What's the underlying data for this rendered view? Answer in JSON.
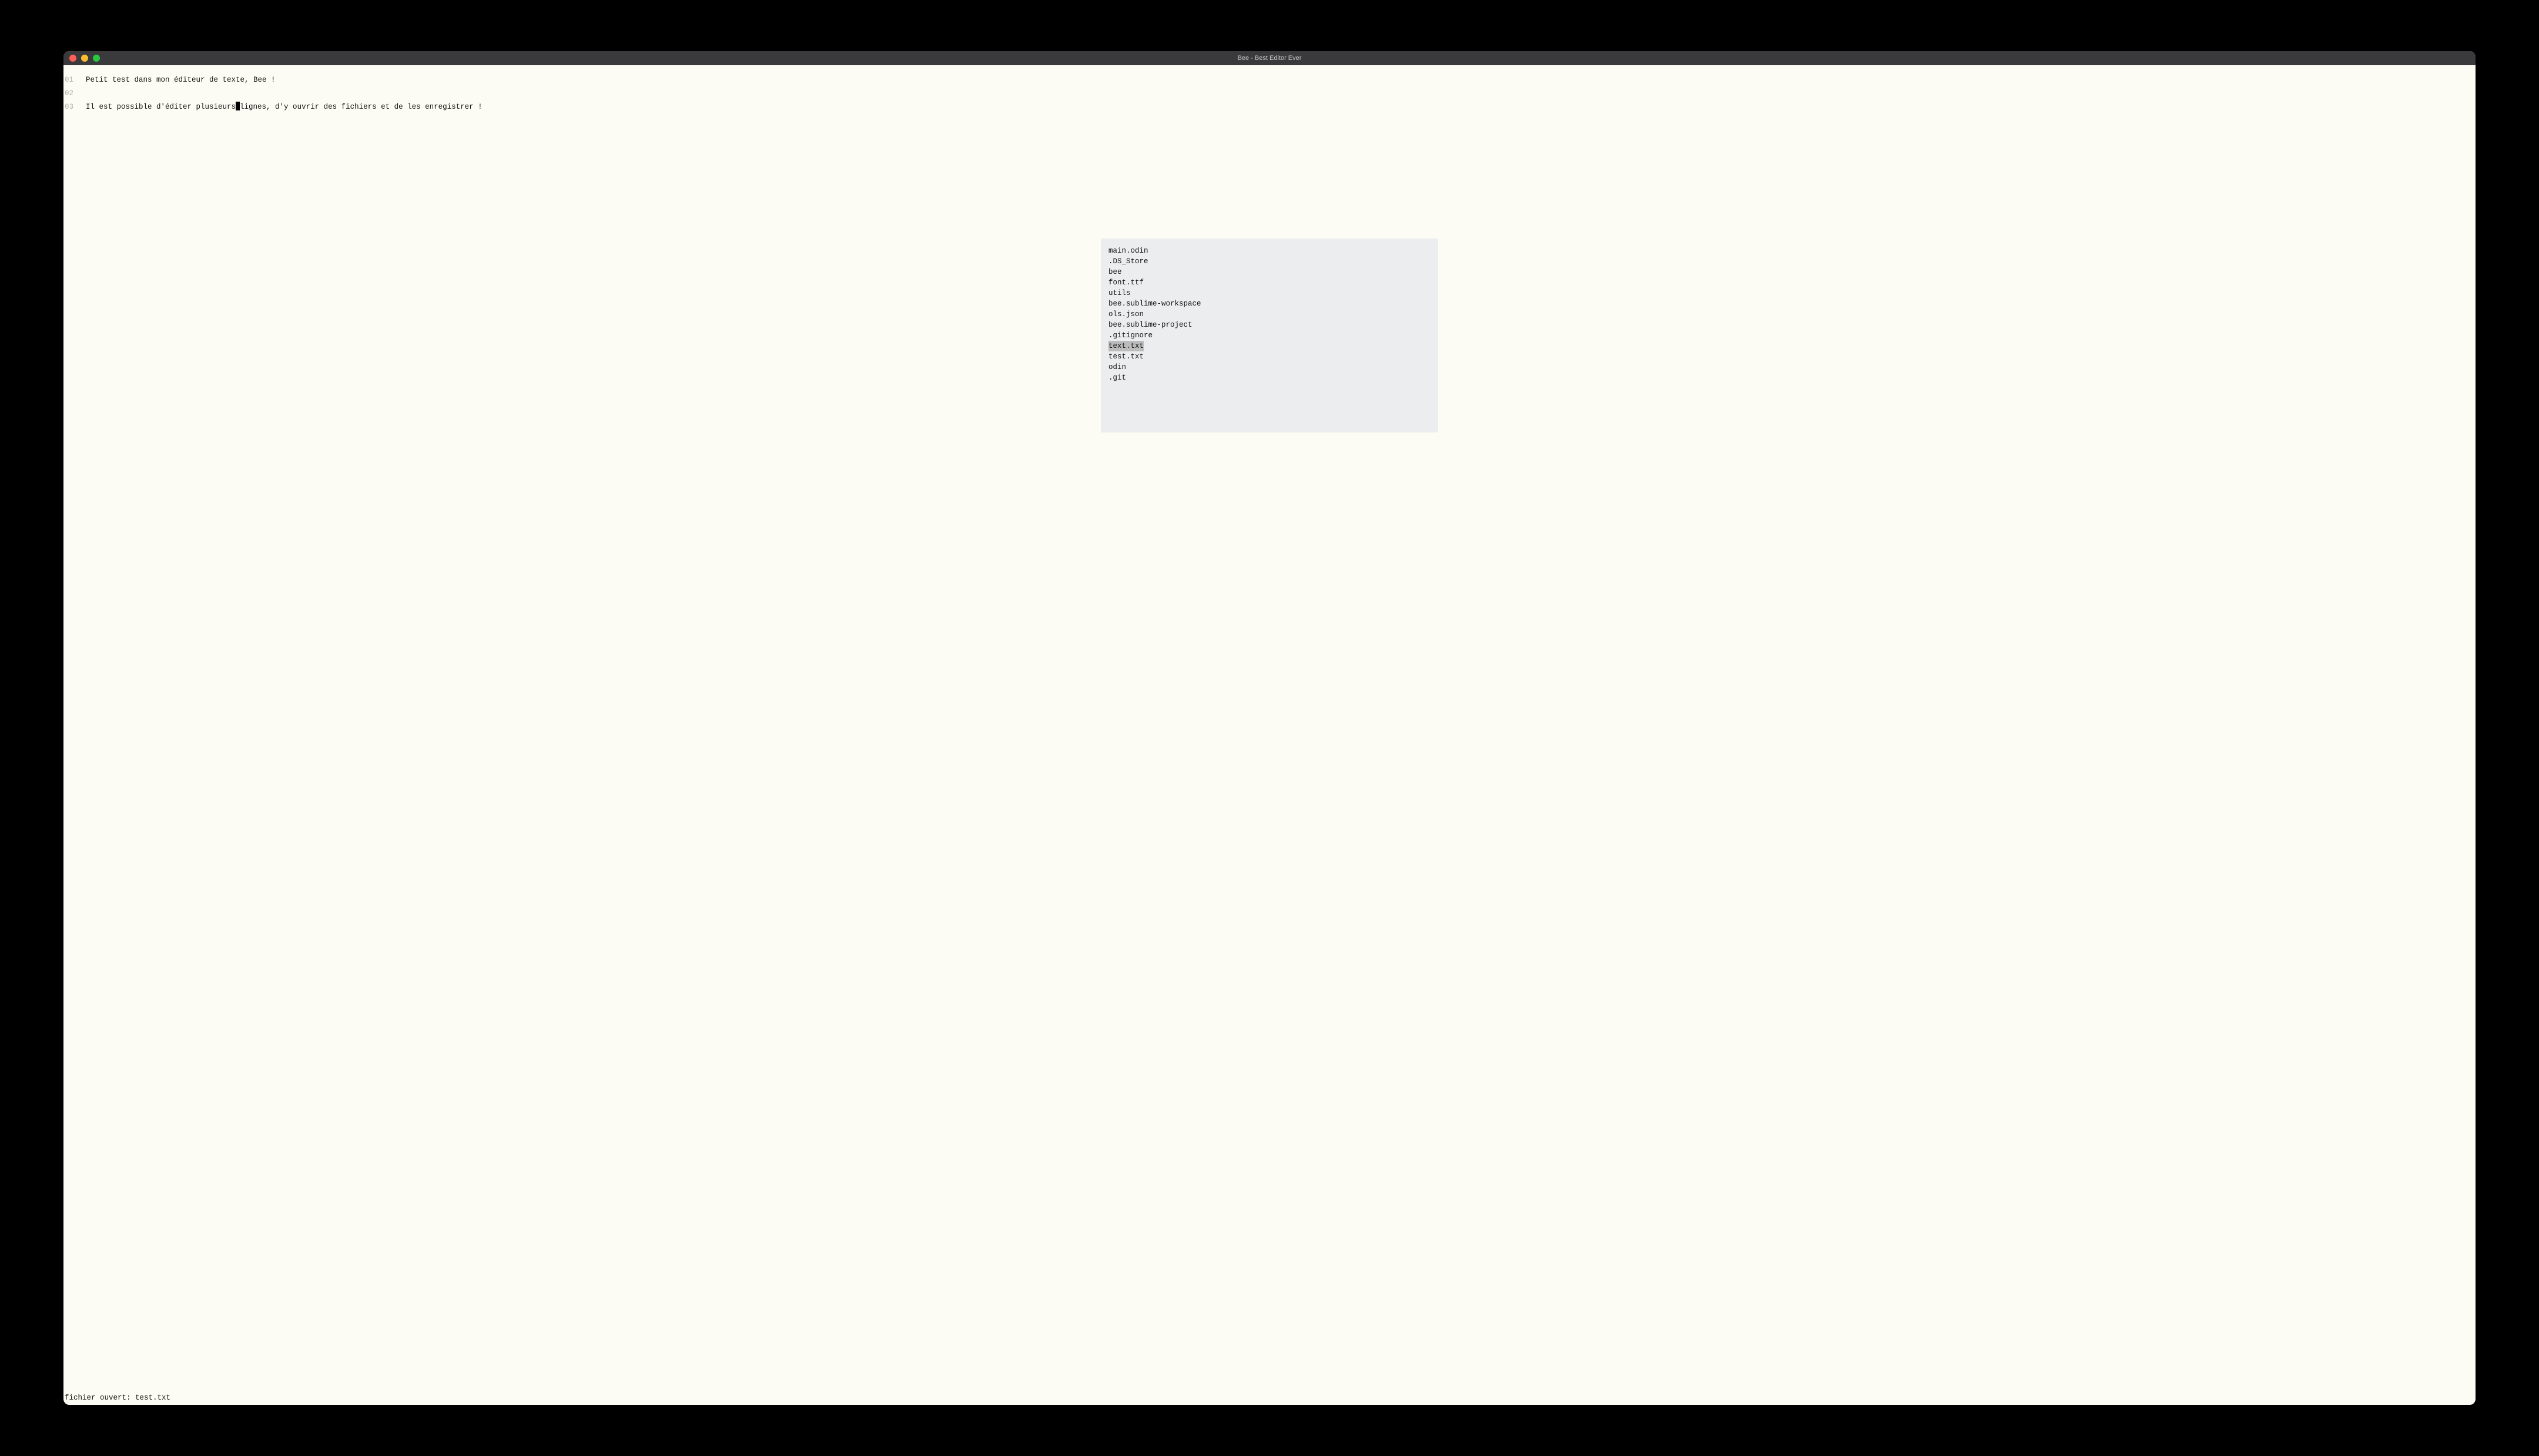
{
  "window": {
    "title": "Bee - Best Editor Ever"
  },
  "editor": {
    "lines": [
      {
        "num": "01",
        "text_before": "Petit test dans mon éditeur de texte, Bee !",
        "has_cursor": false,
        "text_after": ""
      },
      {
        "num": "02",
        "text_before": "",
        "has_cursor": false,
        "text_after": ""
      },
      {
        "num": "03",
        "text_before": "Il est possible d'éditer plusieurs",
        "has_cursor": true,
        "text_after": "lignes, d'y ouvrir des fichiers et de les enregistrer !"
      }
    ]
  },
  "file_picker": {
    "items": [
      {
        "name": "main.odin",
        "selected": false
      },
      {
        "name": ".DS_Store",
        "selected": false
      },
      {
        "name": "bee",
        "selected": false
      },
      {
        "name": "font.ttf",
        "selected": false
      },
      {
        "name": "utils",
        "selected": false
      },
      {
        "name": "bee.sublime-workspace",
        "selected": false
      },
      {
        "name": "ols.json",
        "selected": false
      },
      {
        "name": "bee.sublime-project",
        "selected": false
      },
      {
        "name": ".gitignore",
        "selected": false
      },
      {
        "name": "text.txt",
        "selected": true
      },
      {
        "name": "test.txt",
        "selected": false
      },
      {
        "name": "odin",
        "selected": false
      },
      {
        "name": ".git",
        "selected": false
      }
    ]
  },
  "status": {
    "message": "fichier ouvert: test.txt"
  }
}
